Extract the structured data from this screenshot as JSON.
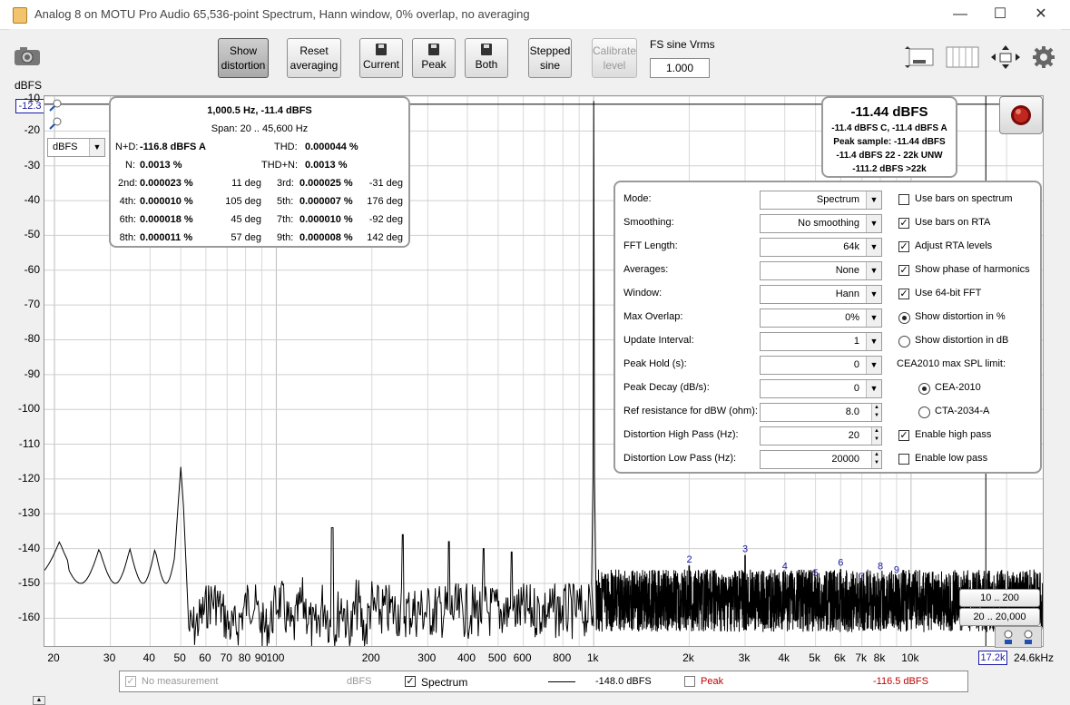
{
  "window": {
    "title": "Analog 8 on MOTU Pro Audio 65,536-point Spectrum, Hann window, 0% overlap, no averaging",
    "minimize": "—",
    "maximize": "☐",
    "close": "✕"
  },
  "toolbar": {
    "show_distortion": [
      "Show",
      "distortion"
    ],
    "reset_averaging": [
      "Reset",
      "averaging"
    ],
    "current": "Current",
    "peak": "Peak",
    "both": "Both",
    "stepped_sine": [
      "Stepped",
      "sine"
    ],
    "calibrate_level": [
      "Calibrate",
      "level"
    ],
    "fs_sine_label": "FS sine Vrms",
    "fs_sine_value": "1.000"
  },
  "plot": {
    "y_unit": "dBFS",
    "y_top_value": "-12.3",
    "y_selector": "dBFS",
    "y_ticks": [
      "-10",
      "-20",
      "-30",
      "-40",
      "-50",
      "-60",
      "-70",
      "-80",
      "-90",
      "-100",
      "-110",
      "-120",
      "-130",
      "-140",
      "-150",
      "-160"
    ],
    "x_ticks": [
      "20",
      "30",
      "40",
      "50",
      "60",
      "70",
      "80",
      "90",
      "100",
      "200",
      "300",
      "400",
      "500",
      "600",
      "800",
      "1k",
      "2k",
      "3k",
      "4k",
      "5k",
      "6k",
      "7k",
      "8k",
      "10k",
      "24.6kHz"
    ],
    "x_cursor_value": "17.2k",
    "harmonic_labels": [
      "2",
      "3",
      "4",
      "5",
      "6",
      "7",
      "8",
      "9"
    ]
  },
  "distortion_panel": {
    "freq_level": "1,000.5 Hz, -11.4 dBFS",
    "span": "Span: 20 .. 45,600 Hz",
    "nd_label": "N+D:",
    "nd_value": "-116.8 dBFS A",
    "thd_label": "THD:",
    "thd_value": "0.000044 %",
    "n_label": "N:",
    "n_value": "0.0013 %",
    "thdn_label": "THD+N:",
    "thdn_value": "0.0013 %",
    "rows": [
      {
        "l1": "2nd:",
        "v1": "0.000023 %",
        "d1": "11 deg",
        "l2": "3rd:",
        "v2": "0.000025 %",
        "d2": "-31 deg"
      },
      {
        "l1": "4th:",
        "v1": "0.000010 %",
        "d1": "105 deg",
        "l2": "5th:",
        "v2": "0.000007 %",
        "d2": "176 deg"
      },
      {
        "l1": "6th:",
        "v1": "0.000018 %",
        "d1": "45 deg",
        "l2": "7th:",
        "v2": "0.000010 %",
        "d2": "-92 deg"
      },
      {
        "l1": "8th:",
        "v1": "0.000011 %",
        "d1": "57 deg",
        "l2": "9th:",
        "v2": "0.000008 %",
        "d2": "142 deg"
      }
    ]
  },
  "level_panel": {
    "main": "-11.44 dBFS",
    "line1": "-11.4 dBFS C, -11.4 dBFS A",
    "line2": "Peak sample: -11.44 dBFS",
    "line3": "-11.4 dBFS 22 - 22k UNW",
    "line4": "-111.2 dBFS >22k"
  },
  "settings": {
    "rows": [
      {
        "label": "Mode:",
        "value": "Spectrum",
        "spin": false
      },
      {
        "label": "Smoothing:",
        "value": "No  smoothing",
        "spin": false
      },
      {
        "label": "FFT Length:",
        "value": "64k",
        "spin": false
      },
      {
        "label": "Averages:",
        "value": "None",
        "spin": false
      },
      {
        "label": "Window:",
        "value": "Hann",
        "spin": false
      },
      {
        "label": "Max Overlap:",
        "value": "0%",
        "spin": false
      },
      {
        "label": "Update Interval:",
        "value": "1",
        "spin": false
      },
      {
        "label": "Peak Hold (s):",
        "value": "0",
        "spin": false
      },
      {
        "label": "Peak Decay (dB/s):",
        "value": "0",
        "spin": false
      },
      {
        "label": "Ref resistance for dBW (ohm):",
        "value": "8.0",
        "spin": true
      },
      {
        "label": "Distortion High Pass (Hz):",
        "value": "20",
        "spin": true
      },
      {
        "label": "Distortion Low Pass (Hz):",
        "value": "20000",
        "spin": true
      }
    ],
    "options": {
      "bars_spectrum": "Use bars on spectrum",
      "bars_rta": "Use bars on RTA",
      "adjust_rta": "Adjust RTA levels",
      "phase_harmonics": "Show phase of harmonics",
      "fft64": "Use 64-bit FFT",
      "dist_percent": "Show distortion in %",
      "dist_db": "Show distortion in dB",
      "cea_label": "CEA2010 max SPL limit:",
      "cea2010": "CEA-2010",
      "cta2034": "CTA-2034-A",
      "high_pass": "Enable high pass",
      "low_pass": "Enable low pass"
    }
  },
  "range_buttons": {
    "r1": "10 .. 200",
    "r2": "20 .. 20,000"
  },
  "legend": {
    "no_meas": "No measurement",
    "no_meas_unit": "dBFS",
    "spectrum": "Spectrum",
    "spectrum_value": "-148.0 dBFS",
    "peak": "Peak",
    "peak_value": "-116.5 dBFS"
  },
  "colors": {
    "peak_text": "#c00000",
    "harmonic_label": "#1a1aa6",
    "cursor_value": "#1a1aa6"
  }
}
